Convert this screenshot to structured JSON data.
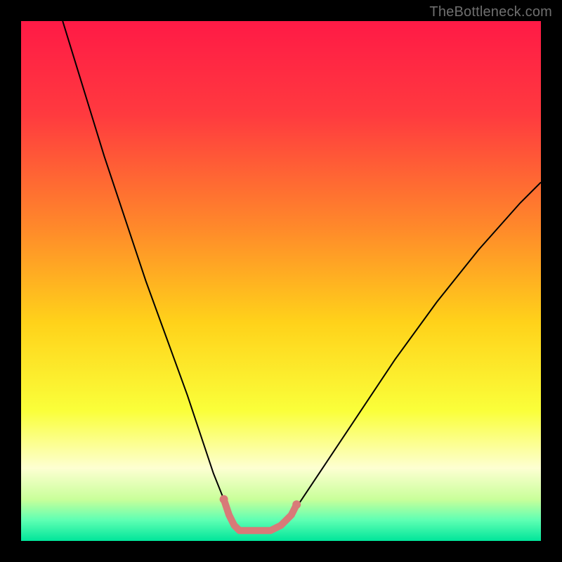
{
  "watermark": "TheBottleneck.com",
  "chart_data": {
    "type": "line",
    "title": "",
    "xlabel": "",
    "ylabel": "",
    "xlim": [
      0,
      100
    ],
    "ylim": [
      0,
      100
    ],
    "grid": false,
    "legend": "none",
    "background_gradient_stops": [
      {
        "offset": 0.0,
        "color": "#ff1a46"
      },
      {
        "offset": 0.18,
        "color": "#ff3a3f"
      },
      {
        "offset": 0.4,
        "color": "#ff8a2a"
      },
      {
        "offset": 0.58,
        "color": "#ffd21a"
      },
      {
        "offset": 0.75,
        "color": "#faff3a"
      },
      {
        "offset": 0.86,
        "color": "#fdffd2"
      },
      {
        "offset": 0.92,
        "color": "#c9ff9a"
      },
      {
        "offset": 0.96,
        "color": "#5effb3"
      },
      {
        "offset": 1.0,
        "color": "#00e59a"
      }
    ],
    "series": [
      {
        "name": "bottleneck-curve",
        "stroke": "#000000",
        "stroke_width": 2,
        "x": [
          8,
          12,
          16,
          20,
          24,
          28,
          32,
          35,
          37,
          39,
          40,
          41,
          42,
          44,
          46,
          48,
          50,
          52,
          54,
          58,
          64,
          72,
          80,
          88,
          96,
          100
        ],
        "y": [
          100,
          87,
          74,
          62,
          50,
          39,
          28,
          19,
          13,
          8,
          5,
          3,
          2,
          2,
          2,
          2,
          3,
          5,
          8,
          14,
          23,
          35,
          46,
          56,
          65,
          69
        ]
      }
    ],
    "highlight_band": {
      "name": "optimum-zone",
      "color": "#d87a78",
      "stroke_width": 10,
      "x": [
        39,
        40,
        41,
        42,
        44,
        46,
        48,
        50,
        52,
        53
      ],
      "y": [
        8,
        5,
        3,
        2,
        2,
        2,
        2,
        3,
        5,
        7
      ]
    }
  }
}
